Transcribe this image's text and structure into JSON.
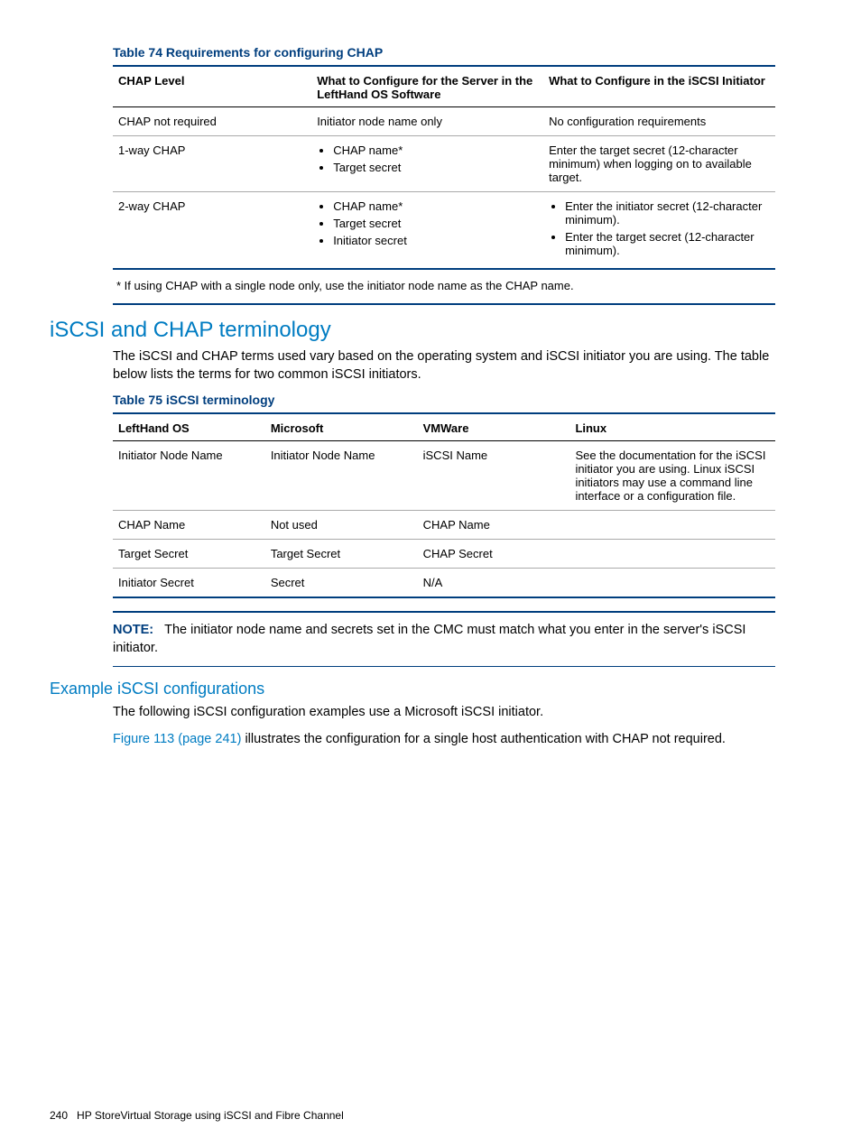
{
  "table74": {
    "title": "Table 74 Requirements for configuring CHAP",
    "headers": {
      "h1": "CHAP Level",
      "h2": "What to Configure for the Server in the LeftHand OS Software",
      "h3": "What to Configure in the iSCSI Initiator"
    },
    "rows": [
      {
        "c1": "CHAP not required",
        "c2_text": "Initiator node name only",
        "c3_text": "No configuration requirements"
      },
      {
        "c1": "1-way CHAP",
        "c2_list": [
          "CHAP name*",
          "Target secret"
        ],
        "c3_text": "Enter the target secret (12-character minimum) when logging on to available target."
      },
      {
        "c1": "2-way CHAP",
        "c2_list": [
          "CHAP name*",
          "Target secret",
          "Initiator secret"
        ],
        "c3_list": [
          "Enter the initiator secret (12-character minimum).",
          "Enter the target secret (12-character minimum)."
        ]
      }
    ],
    "footnote": "* If using CHAP with a single node only, use the initiator node name as the CHAP name."
  },
  "section1": {
    "heading": "iSCSI and CHAP terminology",
    "para": "The iSCSI and CHAP terms used vary based on the operating system and iSCSI initiator you are using. The table below lists the terms for two common iSCSI initiators."
  },
  "table75": {
    "title": "Table 75 iSCSI terminology",
    "headers": {
      "h1": "LeftHand OS",
      "h2": "Microsoft",
      "h3": "VMWare",
      "h4": "Linux"
    },
    "rows": [
      {
        "c1": "Initiator Node Name",
        "c2": "Initiator Node Name",
        "c3": "iSCSI Name",
        "c4": "See the documentation for the iSCSI initiator you are using. Linux iSCSI initiators may use a command line interface or a configuration file."
      },
      {
        "c1": "CHAP Name",
        "c2": "Not used",
        "c3": "CHAP Name",
        "c4": ""
      },
      {
        "c1": "Target Secret",
        "c2": "Target Secret",
        "c3": "CHAP Secret",
        "c4": ""
      },
      {
        "c1": "Initiator Secret",
        "c2": "Secret",
        "c3": "N/A",
        "c4": ""
      }
    ]
  },
  "note": {
    "label": "NOTE:",
    "text": "The initiator node name and secrets set in the CMC must match what you enter in the server's iSCSI initiator."
  },
  "section2": {
    "heading": "Example iSCSI configurations",
    "para1": "The following iSCSI configuration examples use a Microsoft iSCSI initiator.",
    "link": "Figure 113 (page 241)",
    "para2_rest": " illustrates the configuration for a single host authentication with CHAP not required."
  },
  "footer": {
    "page": "240",
    "text": "HP StoreVirtual Storage using iSCSI and Fibre Channel"
  }
}
